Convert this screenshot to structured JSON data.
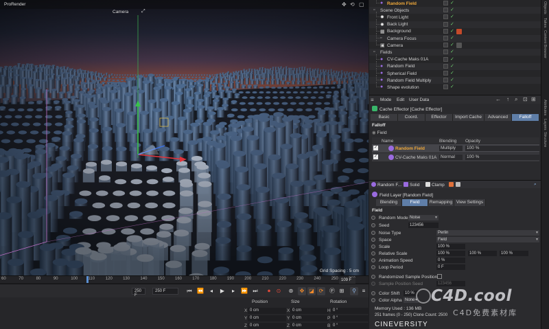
{
  "viewport": {
    "title": "ProRender",
    "camera_label": "Camera",
    "grid_spacing": "Grid Spacing : 5 cm"
  },
  "timeline": {
    "ticks": [
      "60",
      "70",
      "80",
      "90",
      "100",
      "110",
      "120",
      "130",
      "140",
      "150",
      "160",
      "170",
      "180",
      "190",
      "200",
      "210",
      "220",
      "230",
      "240",
      "250",
      "260"
    ],
    "current_frame": "109 F",
    "start_field": "250 F",
    "end_field": "250 F"
  },
  "coordinates": {
    "headers": {
      "position": "Position",
      "size": "Size",
      "rotation": "Rotation"
    },
    "rows": [
      {
        "axis": "X",
        "pos": "0 cm",
        "size": "0 cm",
        "rot_axis": "H",
        "rot": "0 °"
      },
      {
        "axis": "Y",
        "pos": "0 cm",
        "size": "0 cm",
        "rot_axis": "P",
        "rot": "0 °"
      },
      {
        "axis": "Z",
        "pos": "0 cm",
        "size": "0 cm",
        "rot_axis": "B",
        "rot": "0 °"
      }
    ]
  },
  "object_manager": {
    "items": [
      {
        "name": "Random Field",
        "indent": 1,
        "highlight": true,
        "icon": "purple",
        "tag": ""
      },
      {
        "name": "Scene Objects",
        "indent": 0,
        "highlight": false,
        "icon": "null",
        "tag": ""
      },
      {
        "name": "Front Light",
        "indent": 1,
        "highlight": false,
        "icon": "light",
        "tag": ""
      },
      {
        "name": "Back Light",
        "indent": 1,
        "highlight": false,
        "icon": "light",
        "tag": ""
      },
      {
        "name": "Background",
        "indent": 1,
        "highlight": false,
        "icon": "bg",
        "tag": "#c44a2a"
      },
      {
        "name": "Camera Focus",
        "indent": 1,
        "highlight": false,
        "icon": "null",
        "tag": ""
      },
      {
        "name": "Camera",
        "indent": 1,
        "highlight": false,
        "icon": "camera",
        "tag": "#555"
      },
      {
        "name": "Fields",
        "indent": 0,
        "highlight": false,
        "icon": "null",
        "tag": ""
      },
      {
        "name": "CV-Cache Maks 01A",
        "indent": 1,
        "highlight": false,
        "icon": "purple",
        "tag": ""
      },
      {
        "name": "Random Field",
        "indent": 1,
        "highlight": false,
        "icon": "purple",
        "tag": ""
      },
      {
        "name": "Spherical Field",
        "indent": 1,
        "highlight": false,
        "icon": "purple",
        "tag": ""
      },
      {
        "name": "Random Field Multiply",
        "indent": 1,
        "highlight": false,
        "icon": "purple",
        "tag": ""
      },
      {
        "name": "Shape evolution",
        "indent": 1,
        "highlight": false,
        "icon": "purple",
        "tag": ""
      }
    ]
  },
  "attributes": {
    "menu": [
      "Mode",
      "Edit",
      "User Data"
    ],
    "object_title": "Cache Effector [Cache Effector]",
    "tabs": [
      "Basic",
      "Coord.",
      "Effector",
      "Import Cache",
      "Advanced",
      "Falloff"
    ],
    "active_tab": "Falloff",
    "section": "Falloff",
    "field_label": "Field",
    "columns": {
      "name": "Name",
      "blending": "Blending",
      "opacity": "Opacity"
    },
    "fields": [
      {
        "name": "Random Field",
        "blending": "Multiply",
        "opacity": "100 %",
        "selected": true
      },
      {
        "name": "CV-Cache Maks 01A",
        "blending": "Normal",
        "opacity": "100 %",
        "selected": false
      }
    ]
  },
  "field_panel": {
    "toolbar": [
      "Random F...",
      "Solid",
      "Clamp"
    ],
    "layer_title": "Field Layer [Random Field]",
    "tabs": [
      "Blending",
      "Field",
      "Remapping",
      "View Settings"
    ],
    "active_tab": "Field",
    "section": "Field",
    "props": {
      "random_mode": {
        "label": "Random Mode",
        "value": "Noise"
      },
      "seed": {
        "label": "Seed",
        "value": "123456"
      },
      "noise_type": {
        "label": "Noise Type",
        "value": "Perlin"
      },
      "space": {
        "label": "Space",
        "value": "Field"
      },
      "scale": {
        "label": "Scale",
        "value": "100 %"
      },
      "relative_scale": {
        "label": "Relative Scale",
        "v1": "100 %",
        "v2": "100 %",
        "v3": "100 %"
      },
      "animation_speed": {
        "label": "Animation Speed",
        "value": "0 %"
      },
      "loop_period": {
        "label": "Loop Period",
        "value": "0 F"
      },
      "randomized_sample": {
        "label": "Randomized Sample Positions"
      },
      "sample_seed": {
        "label": "Sample Position Seed",
        "value": "123456"
      },
      "color_shift": {
        "label": "Color Shift",
        "value": "10 %"
      },
      "color_alpha": {
        "label": "Color Alpha",
        "value": "None"
      }
    },
    "memory": "Memory Used : 136 MB",
    "frames": "251 frames (0 - 250)   Clone Count: 2500",
    "brand": "CINEVERSITY"
  },
  "strip": [
    "Objects",
    "Takes",
    "Content Browser",
    "Attributes",
    "Layers",
    "Structure"
  ],
  "watermark": {
    "main": "C4D.cool",
    "sub": "C4D免费素材库"
  }
}
